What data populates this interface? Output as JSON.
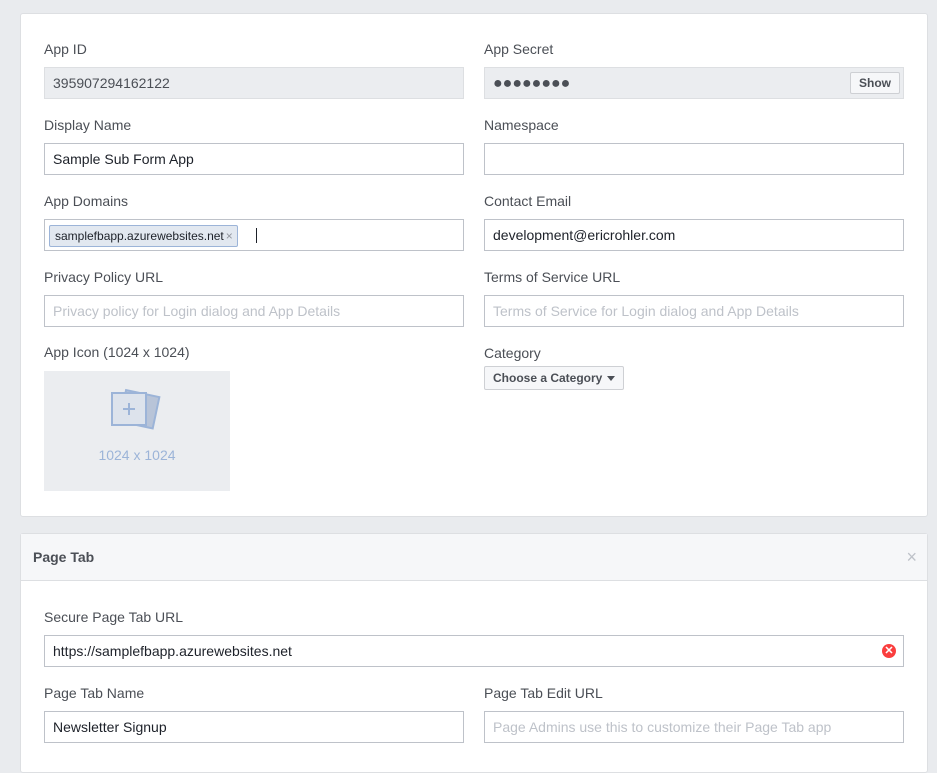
{
  "basic": {
    "app_id": {
      "label": "App ID",
      "value": "395907294162122"
    },
    "app_secret": {
      "label": "App Secret",
      "value": "●●●●●●●●",
      "show_label": "Show"
    },
    "display_name": {
      "label": "Display Name",
      "value": "Sample Sub Form App"
    },
    "namespace": {
      "label": "Namespace",
      "value": ""
    },
    "app_domains": {
      "label": "App Domains",
      "tokens": [
        "samplefbapp.azurewebsites.net"
      ],
      "remove_glyph": "×"
    },
    "contact_email": {
      "label": "Contact Email",
      "value": "development@ericrohler.com"
    },
    "privacy_policy": {
      "label": "Privacy Policy URL",
      "placeholder": "Privacy policy for Login dialog and App Details"
    },
    "terms_of_service": {
      "label": "Terms of Service URL",
      "placeholder": "Terms of Service for Login dialog and App Details"
    },
    "app_icon": {
      "label": "App Icon (1024 x 1024)",
      "size_text": "1024 x 1024",
      "icon": "add-image-icon"
    },
    "category": {
      "label": "Category",
      "button_label": "Choose a Category",
      "icon": "caret-down-icon"
    }
  },
  "page_tab": {
    "title": "Page Tab",
    "close_glyph": "×",
    "secure_url": {
      "label": "Secure Page Tab URL",
      "value": "https://samplefbapp.azurewebsites.net",
      "clear_glyph": "✕"
    },
    "tab_name": {
      "label": "Page Tab Name",
      "value": "Newsletter Signup"
    },
    "edit_url": {
      "label": "Page Tab Edit URL",
      "placeholder": "Page Admins use this to customize their Page Tab app"
    }
  },
  "colors": {
    "background": "#e9ebee",
    "input_border": "#bec2c9",
    "token_bg": "#e2e8f0",
    "token_border": "#9cb4d8",
    "clear_red": "#fa3e3e"
  }
}
